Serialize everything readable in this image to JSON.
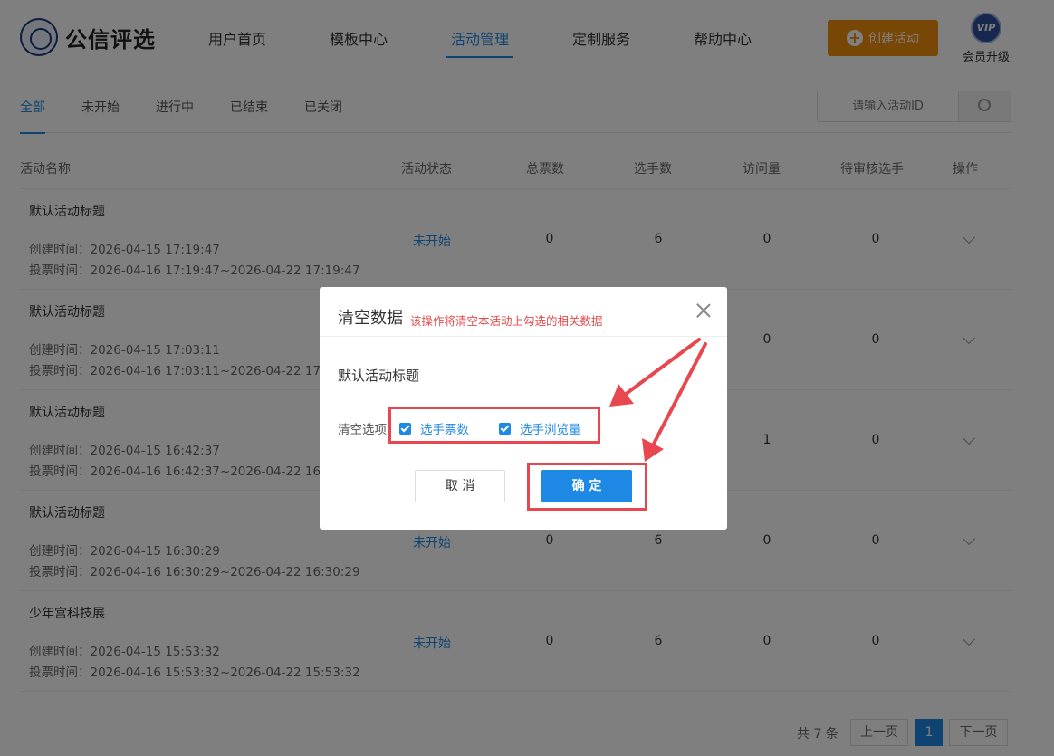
{
  "brand": {
    "name": "公信评选"
  },
  "nav": [
    {
      "label": "用户首页"
    },
    {
      "label": "模板中心"
    },
    {
      "label": "活动管理"
    },
    {
      "label": "定制服务"
    },
    {
      "label": "帮助中心"
    }
  ],
  "header": {
    "create_label": "创建活动",
    "vip_badge": "VIP",
    "vip_label": "会员升级"
  },
  "tabs": [
    {
      "label": "全部"
    },
    {
      "label": "未开始"
    },
    {
      "label": "进行中"
    },
    {
      "label": "已结束"
    },
    {
      "label": "已关闭"
    }
  ],
  "search": {
    "placeholder": "请输入活动ID"
  },
  "table": {
    "columns": [
      "活动名称",
      "活动状态",
      "总票数",
      "选手数",
      "访问量",
      "待审核选手",
      "操作"
    ],
    "rows": [
      {
        "title": "默认活动标题",
        "created": "创建时间：2026-04-15 17:19:47",
        "vote": "投票时间：2026-04-16 17:19:47~2026-04-22 17:19:47",
        "status": "未开始",
        "votes": "0",
        "players": "6",
        "visits": "0",
        "pending": "0"
      },
      {
        "title": "默认活动标题",
        "created": "创建时间：2026-04-15 17:03:11",
        "vote": "投票时间：2026-04-16 17:03:11~2026-04-22 17:03:11",
        "status": "",
        "votes": "",
        "players": "",
        "visits": "0",
        "pending": "0"
      },
      {
        "title": "默认活动标题",
        "created": "创建时间：2026-04-15 16:42:37",
        "vote": "投票时间：2026-04-16 16:42:37~2026-04-22 16:42:37",
        "status": "",
        "votes": "",
        "players": "",
        "visits": "1",
        "pending": "0"
      },
      {
        "title": "默认活动标题",
        "created": "创建时间：2026-04-15 16:30:29",
        "vote": "投票时间：2026-04-16 16:30:29~2026-04-22 16:30:29",
        "status": "未开始",
        "votes": "0",
        "players": "6",
        "visits": "0",
        "pending": "0"
      },
      {
        "title": "少年宫科技展",
        "created": "创建时间：2026-04-15 15:53:32",
        "vote": "投票时间：2026-04-16 15:53:32~2026-04-22 15:53:32",
        "status": "未开始",
        "votes": "0",
        "players": "6",
        "visits": "0",
        "pending": "0"
      }
    ]
  },
  "pagination": {
    "total": "共 7 条",
    "prev": "上一页",
    "current": "1",
    "next": "下一页"
  },
  "modal": {
    "title": "清空数据",
    "subtitle": "该操作将清空本活动上勾选的相关数据",
    "activity_name": "默认活动标题",
    "options_label": "清空选项",
    "options": [
      {
        "label": "选手票数",
        "checked": true
      },
      {
        "label": "选手浏览量",
        "checked": true
      }
    ],
    "cancel_label": "取 消",
    "confirm_label": "确 定"
  },
  "colors": {
    "primary": "#1e88e5",
    "accent": "#f08c0a",
    "annotation": "#e8474f",
    "warning_text": "#e54b4b"
  }
}
